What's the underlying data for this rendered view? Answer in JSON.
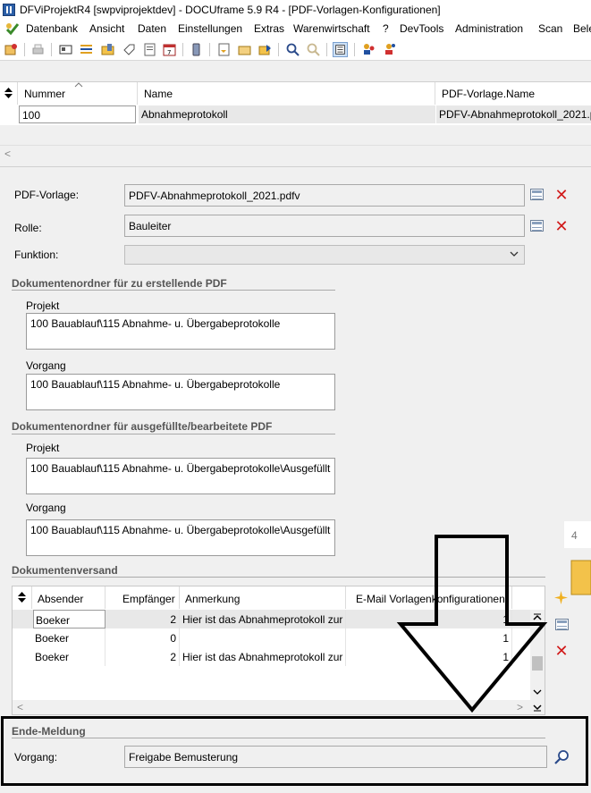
{
  "window": {
    "title": "DFViProjektR4 [swpviprojektdev] - DOCUframe 5.9 R4 - [PDF-Vorlagen-Konfigurationen]"
  },
  "menu": {
    "items": [
      {
        "label": "Datenbank"
      },
      {
        "label": "Ansicht"
      },
      {
        "label": "Daten"
      },
      {
        "label": "Einstellungen"
      },
      {
        "label": "Extras"
      },
      {
        "label": "Warenwirtschaft"
      },
      {
        "label": "?"
      },
      {
        "label": "DevTools"
      },
      {
        "label": "Administration"
      },
      {
        "label": "Scan"
      },
      {
        "label": "Bele"
      }
    ]
  },
  "top_grid": {
    "columns": [
      "Nummer",
      "Name",
      "PDF-Vorlage.Name"
    ],
    "row": {
      "nummer": "100",
      "name": "Abnahmeprotokoll",
      "pdf_vorlage": "PDFV-Abnahmeprotokoll_2021.p"
    }
  },
  "form": {
    "pdf_vorlage_label": "PDF-Vorlage:",
    "pdf_vorlage_value": "PDFV-Abnahmeprotokoll_2021.pdfv",
    "rolle_label": "Rolle:",
    "rolle_value": "Bauleiter",
    "funktion_label": "Funktion:",
    "funktion_value": "",
    "section_erstellen": "Dokumentenordner für zu erstellende PDF",
    "projekt_label": "Projekt",
    "projekt_value_1": "100 Bauablauf\\115 Abnahme- u. Übergabeprotokolle",
    "vorgang_label": "Vorgang",
    "vorgang_value_1": "100 Bauablauf\\115 Abnahme- u. Übergabeprotokolle",
    "section_ausgefuellt": "Dokumentenordner für ausgefüllte/bearbeitete PDF",
    "projekt_value_2": "100 Bauablauf\\115 Abnahme- u. Übergabeprotokolle\\Ausgefüllt",
    "vorgang_value_2": "100 Bauablauf\\115 Abnahme- u. Übergabeprotokolle\\Ausgefüllt",
    "section_versand": "Dokumentenversand"
  },
  "versand_grid": {
    "columns": [
      "Absender",
      "Empfänger",
      "Anmerkung",
      "E-Mail Vorlagenkonfigurationen"
    ],
    "rows": [
      {
        "absender": "Boeker",
        "empfaenger": "2",
        "anmerkung": "Hier ist das Abnahmeprotokoll zur",
        "email": "1"
      },
      {
        "absender": "Boeker",
        "empfaenger": "0",
        "anmerkung": "",
        "email": "1"
      },
      {
        "absender": "Boeker",
        "empfaenger": "2",
        "anmerkung": "Hier ist das Abnahmeprotokoll zur",
        "email": "1"
      }
    ]
  },
  "side_panel": {
    "number": "4"
  },
  "ende_meldung": {
    "section": "Ende-Meldung",
    "vorgang_label": "Vorgang:",
    "vorgang_value": "Freigabe Bemusterung"
  },
  "colors": {
    "selection": "#e8e8e8",
    "delete": "#d11a1a",
    "highlight_box": "#000000"
  }
}
